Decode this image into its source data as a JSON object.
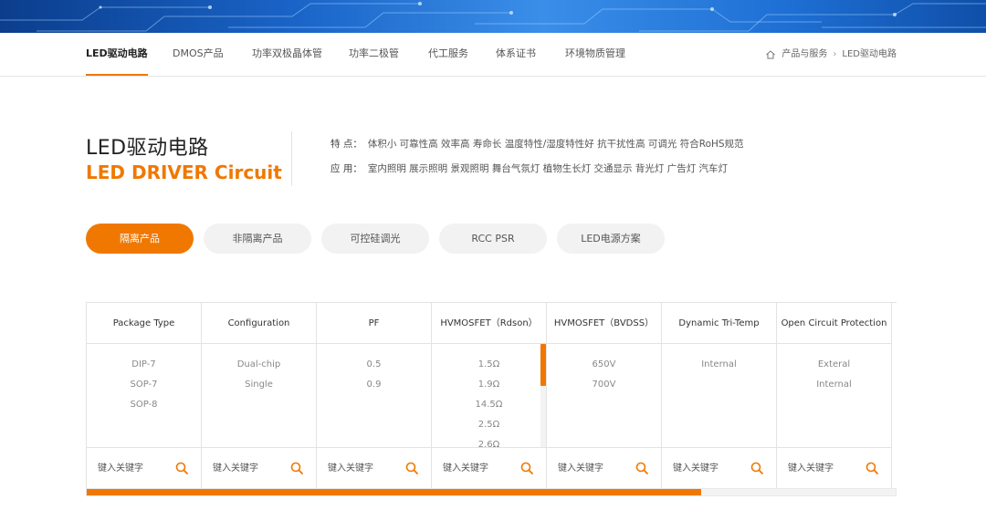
{
  "colors": {
    "accent": "#f07800",
    "banner": "#1a64c8"
  },
  "nav": {
    "items": [
      {
        "label": "LED驱动电路",
        "active": true
      },
      {
        "label": "DMOS产品"
      },
      {
        "label": "功率双极晶体管"
      },
      {
        "label": "功率二极管"
      },
      {
        "label": "代工服务"
      },
      {
        "label": "体系证书"
      },
      {
        "label": "环境物质管理"
      }
    ],
    "breadcrumb": [
      "产品与服务",
      "LED驱动电路"
    ]
  },
  "heading": {
    "title_cn": "LED驱动电路",
    "title_en": "LED DRIVER Circuit",
    "features_label": "特 点：",
    "features": "体积小 可靠性高 效率高 寿命长 温度特性/湿度特性好 抗干扰性高 可调光 符合RoHS规范",
    "applications_label": "应 用：",
    "applications": "室内照明 展示照明 景观照明 舞台气氛灯 植物生长灯 交通显示 背光灯 广告灯 汽车灯"
  },
  "tabs": [
    {
      "label": "隔离产品",
      "active": true
    },
    {
      "label": "非隔离产品"
    },
    {
      "label": "可控硅调光"
    },
    {
      "label": "RCC PSR"
    },
    {
      "label": "LED电源方案"
    }
  ],
  "table": {
    "search_placeholder": "键入关键字",
    "columns": [
      {
        "header": "Package Type",
        "values": [
          "DIP-7",
          "SOP-7",
          "SOP-8"
        ]
      },
      {
        "header": "Configuration",
        "values": [
          "Dual-chip",
          "Single"
        ]
      },
      {
        "header": "PF",
        "values": [
          "0.5",
          "0.9"
        ]
      },
      {
        "header": "HVMOSFET（Rdson）",
        "values": [
          "1.5Ω",
          "1.9Ω",
          "14.5Ω",
          "2.5Ω",
          "2.6Ω"
        ],
        "scroll_fraction": 0.4
      },
      {
        "header": "HVMOSFET（BVDSS）",
        "values": [
          "650V",
          "700V"
        ]
      },
      {
        "header": "Dynamic Tri-Temp",
        "values": [
          "Internal"
        ]
      },
      {
        "header": "Open Circuit Protection",
        "values": [
          "Exteral",
          "Internal"
        ]
      }
    ],
    "horizontal_scroll_fraction": 0.76
  }
}
